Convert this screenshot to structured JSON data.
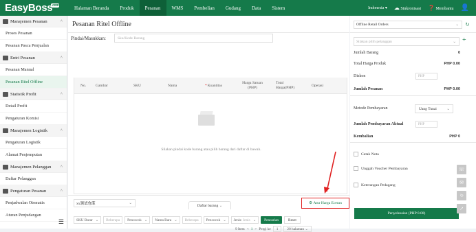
{
  "topbar": {
    "logo": "EasyBoss",
    "logo_badge": ".com",
    "nav": [
      "Halaman Beranda",
      "Produk",
      "Pesanan",
      "WMS",
      "Pembelian",
      "Gudang",
      "Data",
      "Sistem"
    ],
    "active_nav": "Pesanan",
    "region": "Indonesia",
    "sync": "Sinkronisasi",
    "help": "Membantu"
  },
  "sidebar": {
    "groups": [
      {
        "label": "Manajemen Pesanan",
        "items": [
          "Proses Pesanan",
          "Pesanan Pasca Penjualan"
        ]
      },
      {
        "label": "Entri Pesanan",
        "items": [
          "Pesanan Manual",
          "Pesanan Ritel Offline"
        ]
      },
      {
        "label": "Statistik Profit",
        "items": [
          "Detail Profit",
          "Pengaturan Komisi"
        ]
      },
      {
        "label": "Manajemen Logistik",
        "items": [
          "Pengaturan Logistik",
          "Alamat Penjemputan"
        ]
      },
      {
        "label": "Manajemen Pelanggan",
        "items": [
          "Daftar Pelanggan"
        ]
      },
      {
        "label": "Pengaturan Pesanan",
        "items": [
          "Penjadwalan Otomatis",
          "Aturan Penjudangan"
        ]
      }
    ],
    "active_item": "Pesanan Ritel Offline"
  },
  "main": {
    "title": "Pesanan Ritel Offline",
    "scan_label": "Pindai/Masukkan:",
    "scan_placeholder": "Sku/Kode Barang",
    "columns": [
      "No.",
      "Gambar",
      "SKU",
      "Nama",
      "Kuantitas",
      "Harga Satuan (PHP)",
      "Total Harga(PHP)",
      "Operasi"
    ],
    "empty_text": "Silakan pindai kode barang atau pilih barang dari daftar di bawah.",
    "warehouse": "xx测试仓库",
    "goods_list": "Daftar barang",
    "ship_price": "Atur Harga Eceran",
    "filters": {
      "sku_sel": "SKU Barar",
      "sku_input": "Beberapa",
      "match1": "Pencocok",
      "name_sel": "Nama Bara",
      "name_input": "Beberapa",
      "match2": "Pencocok",
      "type_label": "Jenis:",
      "type_value": "Jenis",
      "search": "Pencarian",
      "reset": "Reset"
    },
    "pager": {
      "items": "9 Item",
      "page": "1",
      "goto": "Pergi ke",
      "goto_value": "1",
      "per_page": "20 halaman"
    }
  },
  "right": {
    "orders_select": "Offline Retail Orders",
    "customer_placeholder": "Silakan pilih pelanggan",
    "qty_label": "Jumlah Barang",
    "qty_value": "0",
    "total_label": "Total Harga Produk",
    "total_value": "PHP 0.00",
    "discount_label": "Diskon",
    "discount_input": "PHP",
    "order_total_label": "Jumlah Pesanan",
    "order_total_value": "PHP 0.00",
    "pay_label": "Metode Pembayaran",
    "pay_value": "Uang Tunai",
    "actual_label": "Jumlah Pembayaran Aktual",
    "actual_input": "PHP",
    "change_label": "Kembalian",
    "change_value": "PHP 0",
    "print_note": "Cetak Nota",
    "upload_voucher": "Unggah Voucher Pembayaran",
    "merchant_note": "Keterangan Pedagang",
    "settle": "Penyelesaian (PHP 0.00)"
  },
  "colors": {
    "brand": "#157a4a",
    "highlight": "#e02020"
  }
}
